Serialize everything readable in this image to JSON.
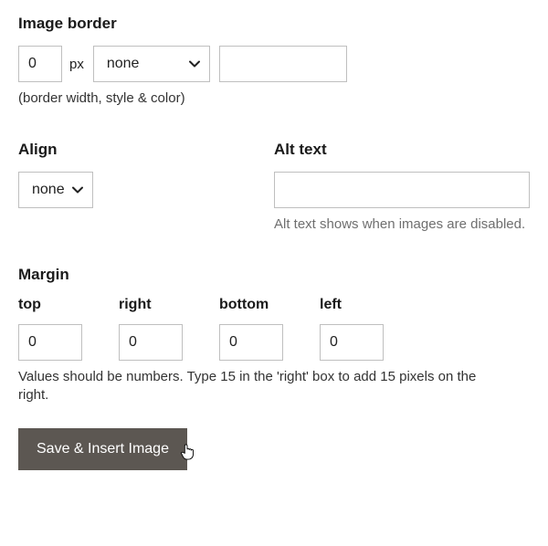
{
  "border": {
    "title": "Image border",
    "width_value": "0",
    "width_unit": "px",
    "style_selected": "none",
    "color_value": "",
    "helper": "(border width, style & color)"
  },
  "align": {
    "title": "Align",
    "selected": "none"
  },
  "alt": {
    "title": "Alt text",
    "value": "",
    "helper": "Alt text shows when images are disabled."
  },
  "margin": {
    "title": "Margin",
    "labels": {
      "top": "top",
      "right": "right",
      "bottom": "bottom",
      "left": "left"
    },
    "values": {
      "top": "0",
      "right": "0",
      "bottom": "0",
      "left": "0"
    },
    "helper": "Values should be numbers. Type 15 in the 'right' box to add 15 pixels on the right."
  },
  "actions": {
    "save_insert": "Save & Insert Image"
  }
}
